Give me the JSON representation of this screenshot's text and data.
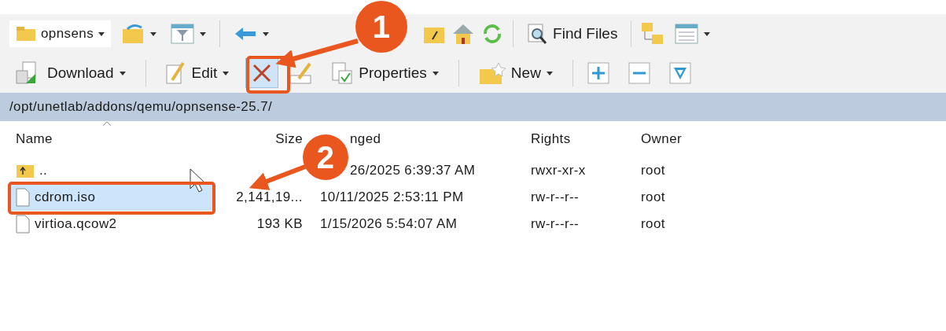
{
  "toolbar_top": {
    "location": "opnsens",
    "find_files": "Find Files"
  },
  "toolbar_bottom": {
    "download": "Download",
    "edit": "Edit",
    "delete": {
      "highlighted": true
    },
    "properties": "Properties",
    "new": "New"
  },
  "path": "/opt/unetlab/addons/qemu/opnsense-25.7/",
  "columns": [
    "Name",
    "Size",
    "nged",
    "Rights",
    "Owner"
  ],
  "rows": [
    {
      "kind": "parent",
      "name": "..",
      "size": "",
      "changed": "26/2025 6:39:37 AM",
      "rights": "rwxr-xr-x",
      "owner": "root",
      "selected": false
    },
    {
      "kind": "file",
      "name": "cdrom.iso",
      "size": "2,141,19...",
      "changed": "10/11/2025 2:53:11 PM",
      "rights": "rw-r--r--",
      "owner": "root",
      "selected": true
    },
    {
      "kind": "file",
      "name": "virtioa.qcow2",
      "size": "193 KB",
      "changed": "1/15/2026 5:54:07 AM",
      "rights": "rw-r--r--",
      "owner": "root",
      "selected": false
    }
  ],
  "annotations": [
    {
      "label": "1"
    },
    {
      "label": "2"
    }
  ]
}
